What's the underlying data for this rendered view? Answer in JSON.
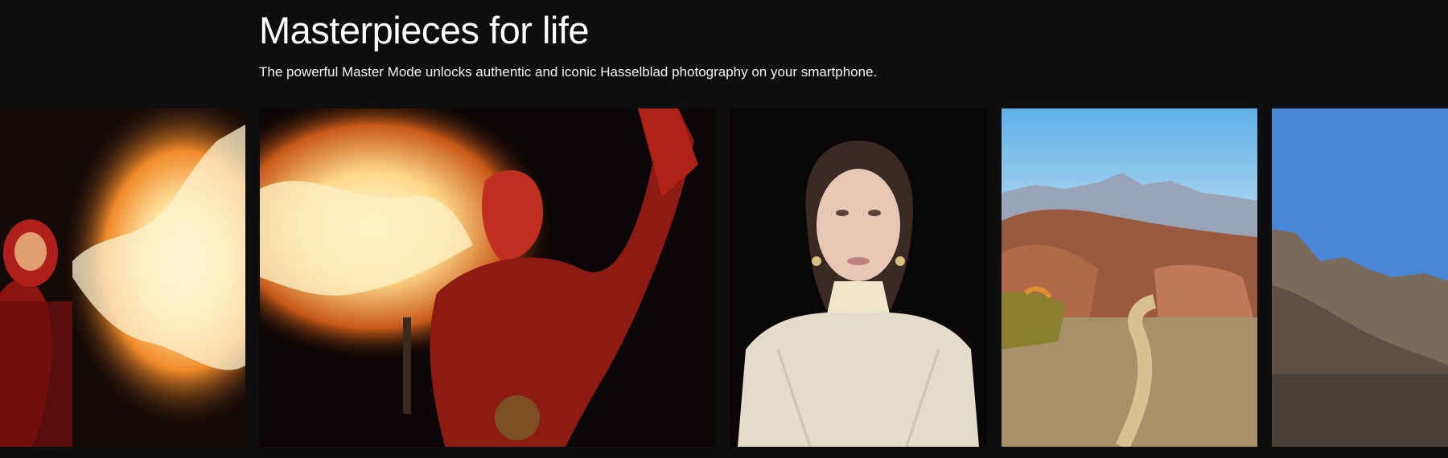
{
  "header": {
    "title": "Masterpieces for life",
    "subtitle": "The powerful Master Mode unlocks authentic and iconic Hasselblad photography on your smartphone."
  },
  "gallery": {
    "photos": [
      {
        "name": "fire-performer-close",
        "description_icon": "fire-breather-photo"
      },
      {
        "name": "fire-performer-torch",
        "description_icon": "fire-breather-photo"
      },
      {
        "name": "portrait-woman-lace",
        "description_icon": "portrait-photo"
      },
      {
        "name": "desert-road-mountains",
        "description_icon": "landscape-photo"
      },
      {
        "name": "rocky-hill-sky",
        "description_icon": "landscape-photo"
      }
    ]
  },
  "colors": {
    "background": "#0e0e0e",
    "text": "#ffffff"
  }
}
